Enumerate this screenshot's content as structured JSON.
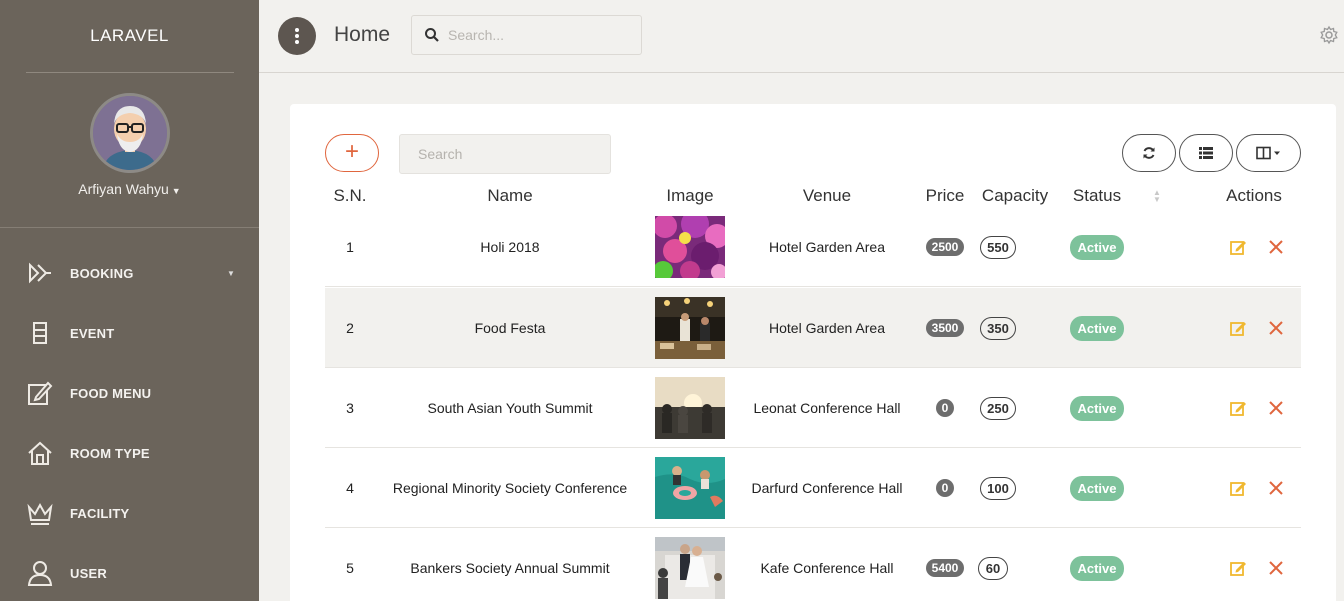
{
  "app": {
    "brand": "LARAVEL"
  },
  "user": {
    "name": "Arfiyan Wahyu"
  },
  "nav": [
    {
      "label": "BOOKING",
      "icon": "booking-icon",
      "has_caret": true
    },
    {
      "label": "EVENT",
      "icon": "event-icon",
      "has_caret": false
    },
    {
      "label": "FOOD MENU",
      "icon": "food-menu-icon",
      "has_caret": false
    },
    {
      "label": "ROOM TYPE",
      "icon": "home-icon",
      "has_caret": false
    },
    {
      "label": "FACILITY",
      "icon": "crown-icon",
      "has_caret": false
    },
    {
      "label": "USER",
      "icon": "user-icon",
      "has_caret": false
    }
  ],
  "header": {
    "title": "Home",
    "search_placeholder": "Search..."
  },
  "table": {
    "search_placeholder": "Search",
    "add_label": "+",
    "columns": [
      "S.N.",
      "Name",
      "Image",
      "Venue",
      "Price",
      "Capacity",
      "Status",
      "Actions"
    ],
    "rows": [
      {
        "sn": "1",
        "name": "Holi 2018",
        "image": "holi-photo",
        "venue": "Hotel Garden Area",
        "price": "2500",
        "capacity": "550",
        "status": "Active"
      },
      {
        "sn": "2",
        "name": "Food Festa",
        "image": "food-festa-photo",
        "venue": "Hotel Garden Area",
        "price": "3500",
        "capacity": "350",
        "status": "Active"
      },
      {
        "sn": "3",
        "name": "South Asian Youth Summit",
        "image": "youth-summit-photo",
        "venue": "Leonat Conference Hall",
        "price": "0",
        "capacity": "250",
        "status": "Active"
      },
      {
        "sn": "4",
        "name": "Regional Minority Society Conference",
        "image": "pool-party-photo",
        "venue": "Darfurd Conference Hall",
        "price": "0",
        "capacity": "100",
        "status": "Active"
      },
      {
        "sn": "5",
        "name": "Bankers Society Annual Summit",
        "image": "wedding-photo",
        "venue": "Kafe Conference Hall",
        "price": "5400",
        "capacity": "60",
        "status": "Active"
      }
    ]
  },
  "colors": {
    "sidebar": "#6b645b",
    "accent": "#e0663e",
    "active": "#7dc29b",
    "edit": "#f0b830",
    "delete": "#e0663e"
  }
}
